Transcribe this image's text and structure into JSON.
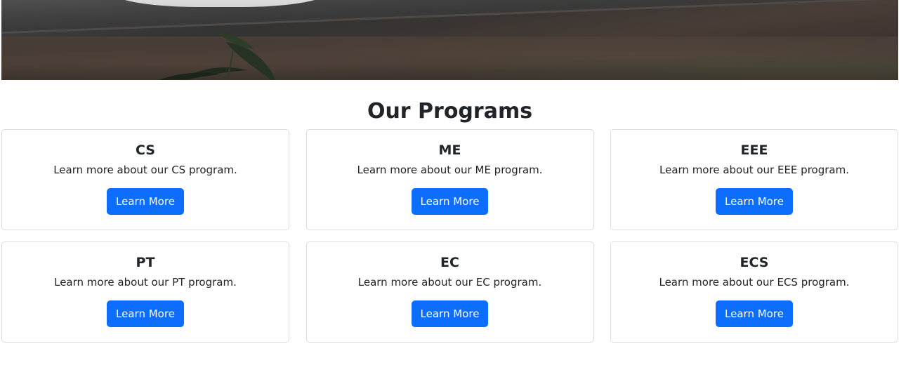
{
  "programs_section": {
    "title": "Our Programs",
    "cards": [
      {
        "name": "CS",
        "description": "Learn more about our CS program.",
        "button_label": "Learn More"
      },
      {
        "name": "ME",
        "description": "Learn more about our ME program.",
        "button_label": "Learn More"
      },
      {
        "name": "EEE",
        "description": "Learn more about our EEE program.",
        "button_label": "Learn More"
      },
      {
        "name": "PT",
        "description": "Learn more about our PT program.",
        "button_label": "Learn More"
      },
      {
        "name": "EC",
        "description": "Learn more about our EC program.",
        "button_label": "Learn More"
      },
      {
        "name": "ECS",
        "description": "Learn more about our ECS program.",
        "button_label": "Learn More"
      }
    ]
  },
  "colors": {
    "primary_button": "#0d6efd",
    "card_border": "#dcdcdc",
    "text": "#212529"
  }
}
